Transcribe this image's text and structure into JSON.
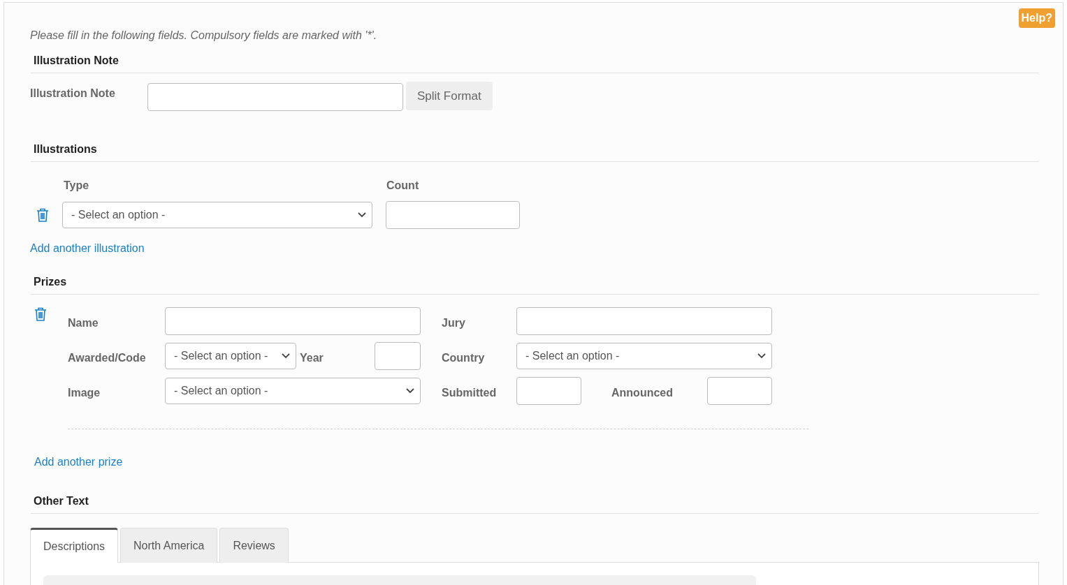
{
  "help_button": "Help?",
  "intro": "Please fill in the following fields. Compulsory fields are marked with '*'.",
  "illustration_note": {
    "heading": "Illustration Note",
    "label": "Illustration Note",
    "button": "Split Format"
  },
  "illustrations": {
    "heading": "Illustrations",
    "columns": [
      "Type",
      "Count"
    ],
    "rows": [
      {
        "type_select": "- Select an option -"
      }
    ],
    "add_link": "Add another illustration"
  },
  "prizes": {
    "heading": "Prizes",
    "items": [
      {
        "name_label": "Name",
        "jury_label": "Jury",
        "awarded_label": "Awarded/Code",
        "awarded_select": "- Select an option -",
        "year_label": "Year",
        "country_label": "Country",
        "country_select": "- Select an option -",
        "image_label": "Image",
        "image_select": "- Select an option -",
        "submitted_label": "Submitted",
        "announced_label": "Announced"
      }
    ],
    "add_link": "Add another prize"
  },
  "other_text": {
    "heading": "Other Text",
    "tabs": [
      {
        "label": "Descriptions",
        "selected": true
      },
      {
        "label": "North America",
        "selected": false
      },
      {
        "label": "Reviews",
        "selected": false
      }
    ]
  }
}
